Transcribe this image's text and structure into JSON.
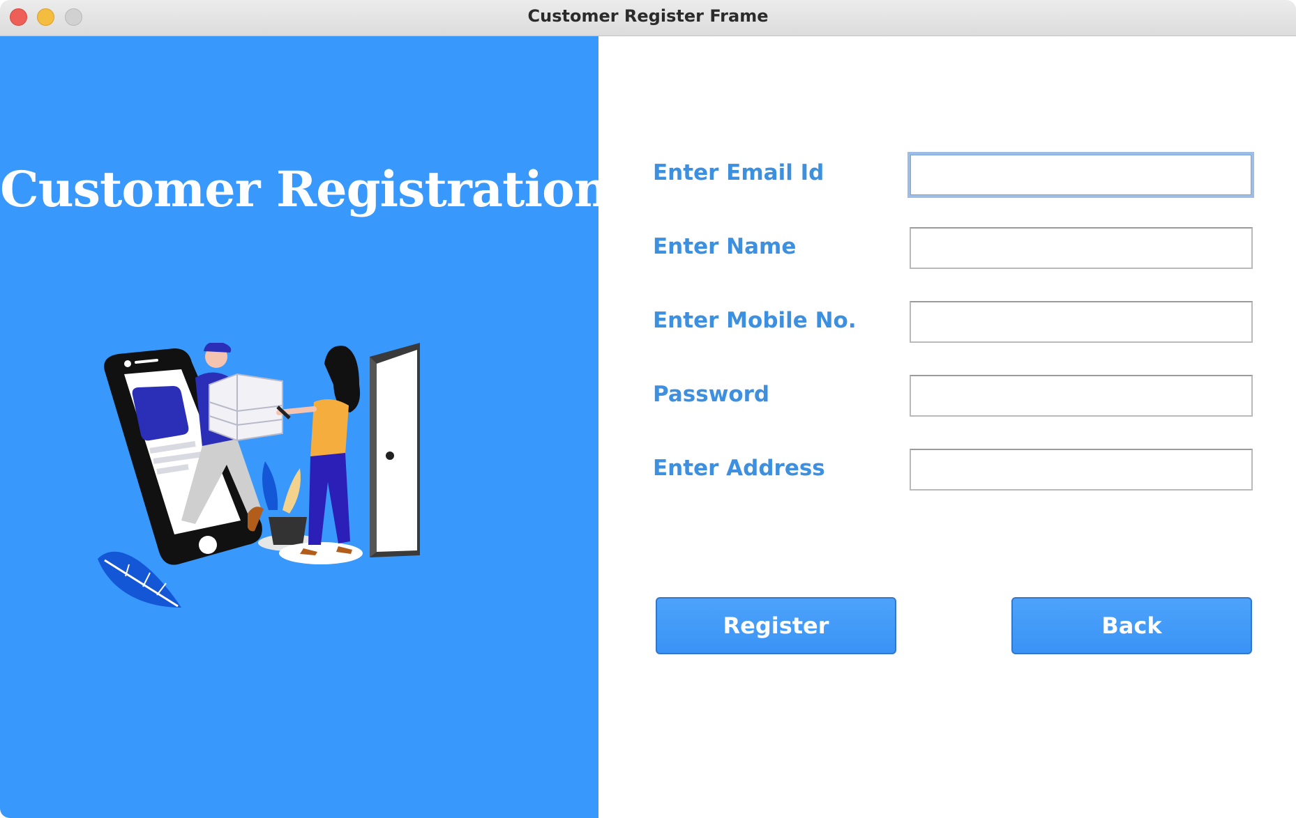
{
  "window": {
    "title": "Customer Register Frame"
  },
  "left_panel": {
    "heading": "Customer Registration",
    "background_color": "#3898fc"
  },
  "form": {
    "label_color": "#3d8fe0",
    "fields": [
      {
        "label": "Enter Email Id",
        "value": "",
        "placeholder": ""
      },
      {
        "label": "Enter Name",
        "value": "",
        "placeholder": ""
      },
      {
        "label": "Enter Mobile No.",
        "value": "",
        "placeholder": ""
      },
      {
        "label": "Password",
        "value": "",
        "placeholder": ""
      },
      {
        "label": "Enter Address",
        "value": "",
        "placeholder": ""
      }
    ]
  },
  "buttons": {
    "register_label": "Register",
    "back_label": "Back"
  }
}
